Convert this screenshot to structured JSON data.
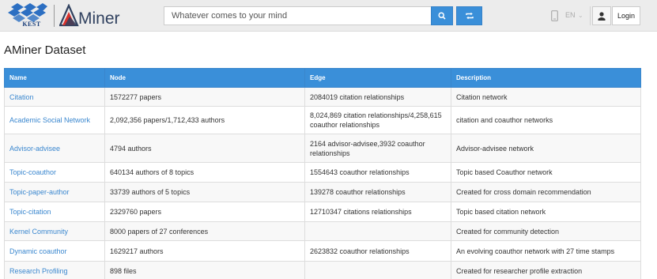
{
  "header": {
    "logo_kest": "KEST",
    "logo_aminer": "Miner",
    "search_placeholder": "Whatever comes to your mind",
    "lang": "EN",
    "lang_caret": "⌄",
    "login_label": "Login"
  },
  "page_title": "AMiner Dataset",
  "table": {
    "headers": [
      "Name",
      "Node",
      "Edge",
      "Description"
    ],
    "rows": [
      {
        "name": "Citation",
        "node": "1572277 papers",
        "edge": "2084019 citation relationships",
        "desc": "Citation network"
      },
      {
        "name": "Academic Social Network",
        "node": "2,092,356 papers/1,712,433 authors",
        "edge": "8,024,869 citation relationships/4,258,615 coauthor relationships",
        "desc": "citation and coauthor networks"
      },
      {
        "name": "Advisor-advisee",
        "node": "4794 authors",
        "edge": "2164 advisor-advisee,3932 coauthor relationships",
        "desc": "Advisor-advisee network"
      },
      {
        "name": "Topic-coauthor",
        "node": "640134 authors of 8 topics",
        "edge": "1554643 coauthor relationships",
        "desc": "Topic based Coauthor network"
      },
      {
        "name": "Topic-paper-author",
        "node": "33739 authors of 5 topics",
        "edge": "139278 coauthor relationships",
        "desc": "Created for cross domain recommendation"
      },
      {
        "name": "Topic-citation",
        "node": "2329760 papers",
        "edge": "12710347 citations relationships",
        "desc": "Topic based citation network"
      },
      {
        "name": "Kernel Community",
        "node": "8000 papers of 27 conferences",
        "edge": "",
        "desc": "Created for community detection"
      },
      {
        "name": "Dynamic coauthor",
        "node": "1629217 authors",
        "edge": "2623832 coauthor relationships",
        "desc": "An evolving coauthor network with 27 time stamps"
      },
      {
        "name": "Research Profiling",
        "node": "898 files",
        "edge": "",
        "desc": "Created for researcher profile extraction"
      }
    ]
  },
  "icons": {
    "search": "search-icon",
    "swap": "swap-icon",
    "mobile": "mobile-phone-icon",
    "user": "user-icon"
  },
  "colors": {
    "accent": "#3a8fd9",
    "link": "#3a87cf",
    "topbar": "#ececec",
    "logo_navy": "#1b3f7a"
  }
}
